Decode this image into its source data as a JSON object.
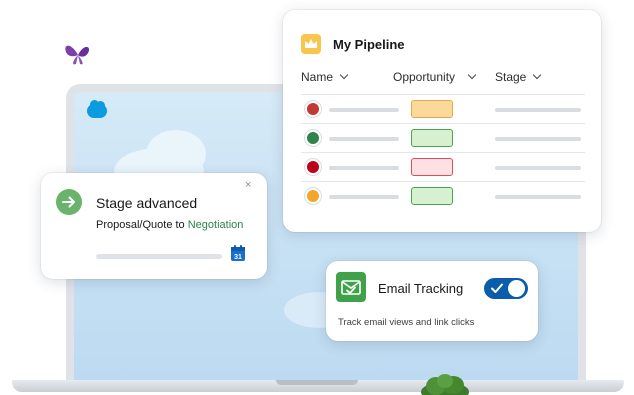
{
  "pipeline": {
    "title": "My Pipeline",
    "icon": "crown-icon",
    "columns": [
      "Name",
      "Opportunity",
      "Stage"
    ],
    "rows": [
      {
        "avatar_color": "#c23934",
        "opportunity_fill": "#fbd99b",
        "opportunity_border": "#e8a84c"
      },
      {
        "avatar_color": "#2e844a",
        "opportunity_fill": "#d6f0d0",
        "opportunity_border": "#4aa34f"
      },
      {
        "avatar_color": "#ba0517",
        "opportunity_fill": "#fde0e3",
        "opportunity_border": "#e04c5a"
      },
      {
        "avatar_color": "#f4a62a",
        "opportunity_fill": "#d6f0d0",
        "opportunity_border": "#4aa34f"
      }
    ]
  },
  "stage_card": {
    "title": "Stage advanced",
    "subtitle_prefix": "Proposal/Quote to ",
    "subtitle_highlight": "Negotiation",
    "close_label": "×",
    "icon": "arrow-right-icon",
    "calendar_day": "31"
  },
  "email_card": {
    "title": "Email Tracking",
    "subtitle": "Track email views and link clicks",
    "toggle_on": true,
    "icon": "email-check-icon"
  },
  "colors": {
    "accent": "#0b5cab",
    "green": "#3fa24a",
    "brand": "#0b9be0"
  }
}
